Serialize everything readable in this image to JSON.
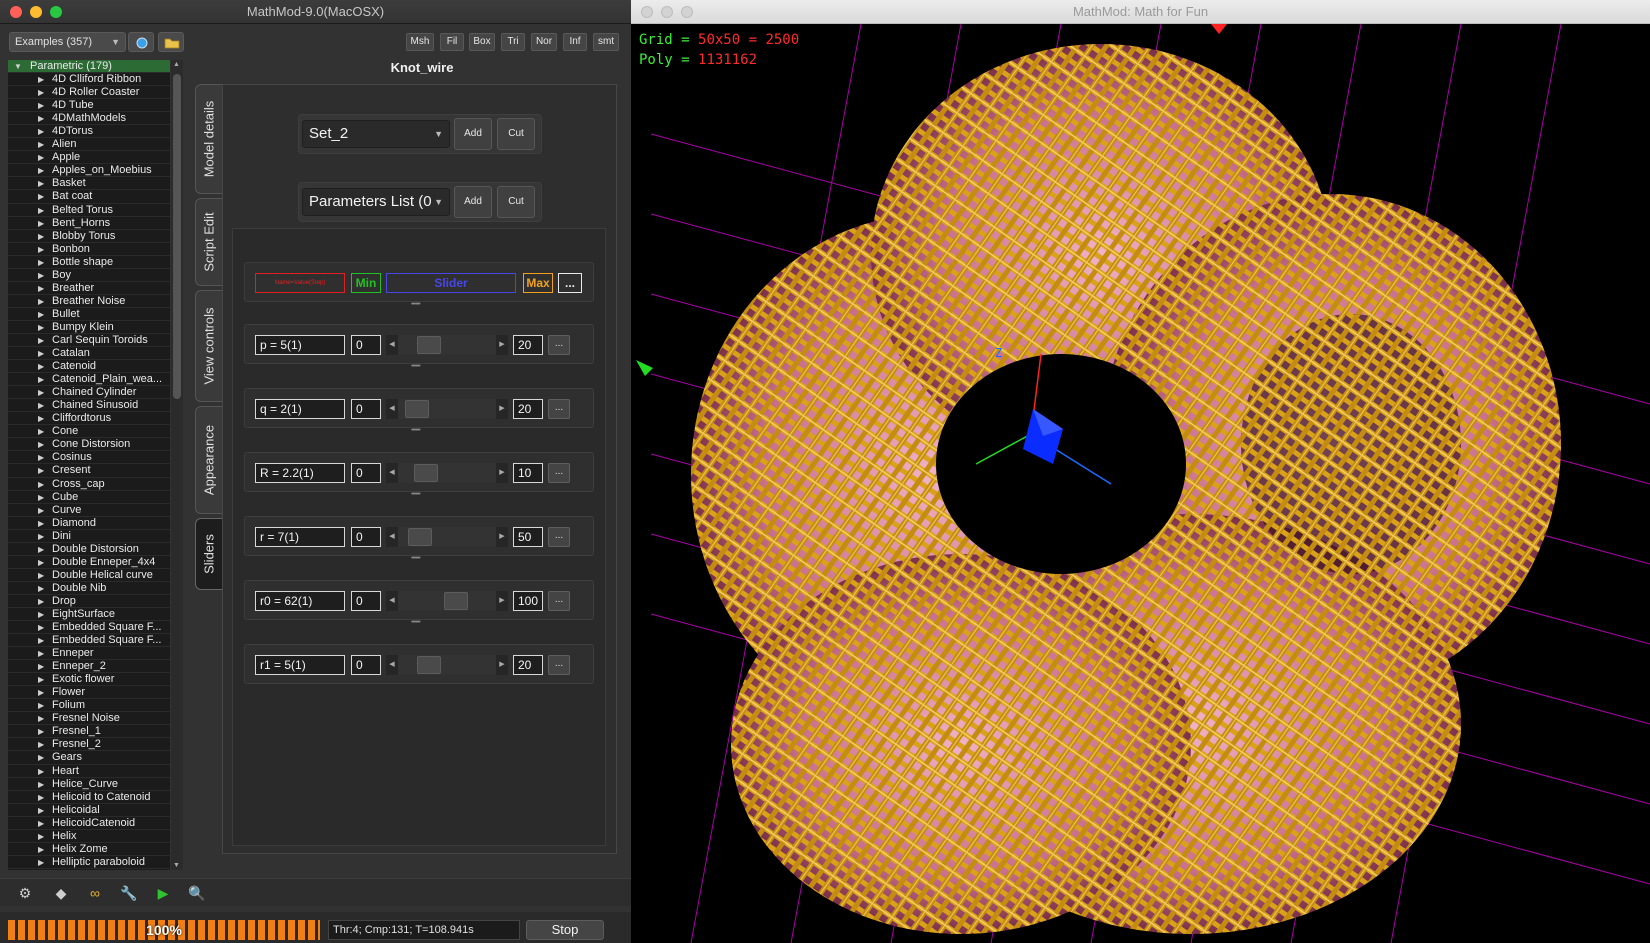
{
  "left_window": {
    "title": "MathMod-9.0(MacOSX)",
    "examples_select": "Examples (357)",
    "format_buttons": [
      "Msh",
      "Fil",
      "Box",
      "Tri",
      "Nor",
      "Inf",
      "smt"
    ],
    "tree": {
      "root": "Parametric (179)",
      "items": [
        "4D Clliford Ribbon",
        "4D Roller Coaster",
        "4D Tube",
        "4DMathModels",
        "4DTorus",
        "Alien",
        "Apple",
        "Apples_on_Moebius",
        "Basket",
        "Bat coat",
        "Belted Torus",
        "Bent_Horns",
        "Blobby Torus",
        "Bonbon",
        "Bottle shape",
        "Boy",
        "Breather",
        "Breather Noise",
        "Bullet",
        "Bumpy Klein",
        "Carl Sequin Toroids",
        "Catalan",
        "Catenoid",
        "Catenoid_Plain_wea...",
        "Chained Cylinder",
        "Chained Sinusoid",
        "Cliffordtorus",
        "Cone",
        "Cone Distorsion",
        "Cosinus",
        "Cresent",
        "Cross_cap",
        "Cube",
        "Curve",
        "Diamond",
        "Dini",
        "Double Distorsion",
        "Double Enneper_4x4",
        "Double Helical curve",
        "Double Nib",
        "Drop",
        "EightSurface",
        "Embedded Square F...",
        "Embedded Square F...",
        "Enneper",
        "Enneper_2",
        "Exotic flower",
        "Flower",
        "Folium",
        "Fresnel Noise",
        "Fresnel_1",
        "Fresnel_2",
        "Gears",
        "Heart",
        "Helice_Curve",
        "Helicoid to Catenoid",
        "Helicoidal",
        "HelicoidCatenoid",
        "Helix",
        "Helix Zome",
        "Helliptic paraboloid"
      ]
    },
    "tabs": [
      "Model details",
      "Script Edit",
      "View controls",
      "Appearance",
      "Sliders"
    ],
    "active_tab": "Sliders",
    "model_name": "Knot_wire",
    "set_combo": "Set_2",
    "params_combo": "Parameters List  (0",
    "add_label": "Add",
    "cut_label": "Cut",
    "slider_header": {
      "name": "Name=Value(Step)",
      "min": "Min",
      "slider": "Slider",
      "max": "Max",
      "more": "..."
    },
    "sliders": [
      {
        "name": "p = 5(1)",
        "min": "0",
        "max": "20",
        "pos": 0.25
      },
      {
        "name": "q = 2(1)",
        "min": "0",
        "max": "20",
        "pos": 0.1
      },
      {
        "name": "R = 2.2(1)",
        "min": "0",
        "max": "10",
        "pos": 0.22
      },
      {
        "name": "r = 7(1)",
        "min": "0",
        "max": "50",
        "pos": 0.14
      },
      {
        "name": "r0 = 62(1)",
        "min": "0",
        "max": "100",
        "pos": 0.62
      },
      {
        "name": "r1 = 5(1)",
        "min": "0",
        "max": "20",
        "pos": 0.25
      }
    ],
    "more_label": "...",
    "progress": {
      "label": "100%",
      "value": 100
    },
    "stats": "Thr:4; Cmp:131; T=108.941s",
    "stop_label": "Stop"
  },
  "right_window": {
    "title": "MathMod: Math for Fun",
    "hud": {
      "grid_key": "Grid = ",
      "grid_val": "50x50 = 2500",
      "poly_key": "Poly = ",
      "poly_val": "1131162"
    },
    "axis_y": "Y",
    "axis_z": "Z"
  },
  "colors": {
    "gold": "#d9a21a",
    "pink": "#d88aa6",
    "grid": "#ff00ff",
    "hud_red": "#ff2b2b",
    "hud_green": "#3cf03c",
    "progress": "#f07f15"
  }
}
